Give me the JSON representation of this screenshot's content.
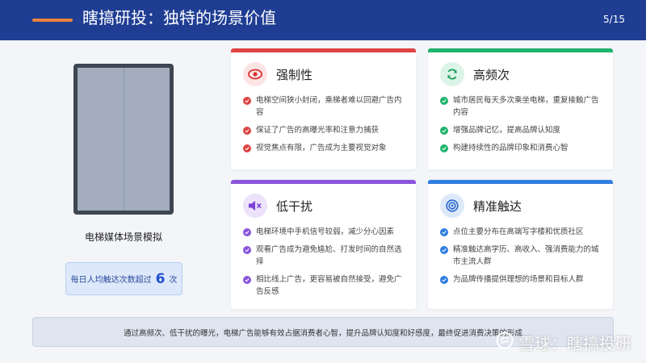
{
  "header": {
    "title": "瞎搞研投：独特的场景价值",
    "page": "5/15"
  },
  "left": {
    "elevator_label": "电梯媒体场景模拟",
    "stat_prefix": "每日人均触达次数超过",
    "stat_number": "6",
    "stat_suffix": "次"
  },
  "cards": [
    {
      "title": "强制性",
      "color": "#e04343",
      "icon": "eye-icon",
      "items": [
        "电梯空间狭小封闭，乘梯者难以回避广告内容",
        "保证了广告的高曝光率和注意力捕获",
        "视觉焦点有限，广告成为主要视觉对象"
      ]
    },
    {
      "title": "高频次",
      "color": "#1fb36b",
      "icon": "refresh-icon",
      "items": [
        "城市居民每天多次乘坐电梯，重复接触广告内容",
        "增强品牌记忆，提高品牌认知度",
        "构建持续性的品牌印象和消费心智"
      ]
    },
    {
      "title": "低干扰",
      "color": "#8a55dc",
      "icon": "mute-icon",
      "items": [
        "电梯环境中手机信号较弱，减少分心因素",
        "观看广告成为避免尴尬、打发时间的自然选择",
        "相比线上广告，更容易被自然接受，避免广告反感"
      ]
    },
    {
      "title": "精准触达",
      "color": "#2f7ee0",
      "icon": "target-icon",
      "items": [
        "点位主要分布在高端写字楼和优质社区",
        "精准触达高学历、高收入、强消费能力的城市主流人群",
        "为品牌传播提供理想的场景和目标人群"
      ]
    }
  ],
  "footer": {
    "text": "通过高频次、低干扰的曝光，电梯广告能够有效占据消费者心智，提升品牌认知度和好感度，最终促进消费决策的形成"
  },
  "watermark": {
    "text": "雪球：瞎搞投研"
  }
}
